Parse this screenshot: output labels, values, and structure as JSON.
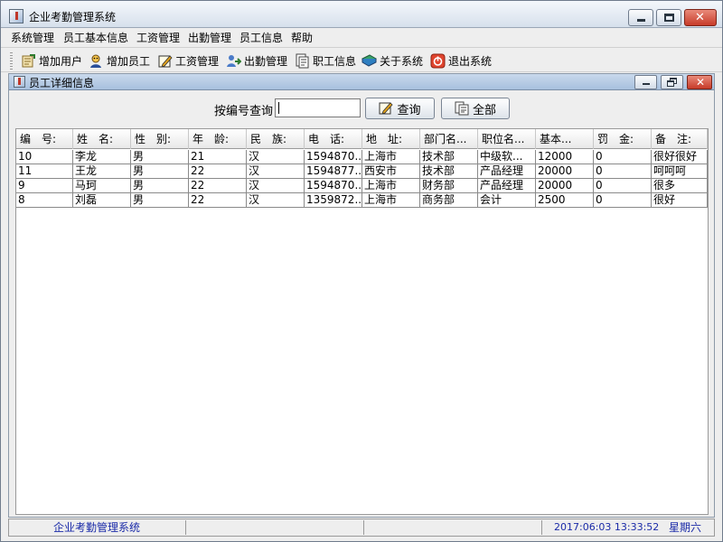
{
  "window": {
    "title": "企业考勤管理系统"
  },
  "menu": [
    "系统管理",
    "员工基本信息",
    "工资管理",
    "出勤管理",
    "员工信息",
    "帮助"
  ],
  "toolbar": [
    {
      "label": "增加用户",
      "icon": "add-user-icon"
    },
    {
      "label": "增加员工",
      "icon": "add-employee-icon"
    },
    {
      "label": "工资管理",
      "icon": "salary-edit-icon"
    },
    {
      "label": "出勤管理",
      "icon": "attendance-icon"
    },
    {
      "label": "职工信息",
      "icon": "staff-info-icon"
    },
    {
      "label": "关于系统",
      "icon": "about-book-icon"
    },
    {
      "label": "退出系统",
      "icon": "power-exit-icon"
    }
  ],
  "inner": {
    "title": "员工详细信息",
    "search_label": "按编号查询",
    "search_value": "",
    "query_button": "查询",
    "all_button": "全部"
  },
  "table": {
    "columns": [
      "编　号:",
      "姓　名:",
      "性　别:",
      "年　龄:",
      "民　族:",
      "电　话:",
      "地　址:",
      "部门名...",
      "职位名...",
      "基本...",
      "罚　金:",
      "备　注:"
    ],
    "rows": [
      [
        "10",
        "李龙",
        "男",
        "21",
        "汉",
        "1594870...",
        "上海市",
        "技术部",
        "中级软...",
        "12000",
        "0",
        "很好很好"
      ],
      [
        "11",
        "王龙",
        "男",
        "22",
        "汉",
        "1594877...",
        "西安市",
        "技术部",
        "产品经理",
        "20000",
        "0",
        "呵呵呵"
      ],
      [
        "9",
        "马珂",
        "男",
        "22",
        "汉",
        "1594870...",
        "上海市",
        "财务部",
        "产品经理",
        "20000",
        "0",
        "很多"
      ],
      [
        "8",
        "刘磊",
        "男",
        "22",
        "汉",
        "1359872...",
        "上海市",
        "商务部",
        "会计",
        "2500",
        "0",
        "很好"
      ]
    ]
  },
  "status": {
    "app_name": "企业考勤管理系统",
    "datetime": "2017:06:03  13:33:52",
    "weekday": "星期六"
  }
}
